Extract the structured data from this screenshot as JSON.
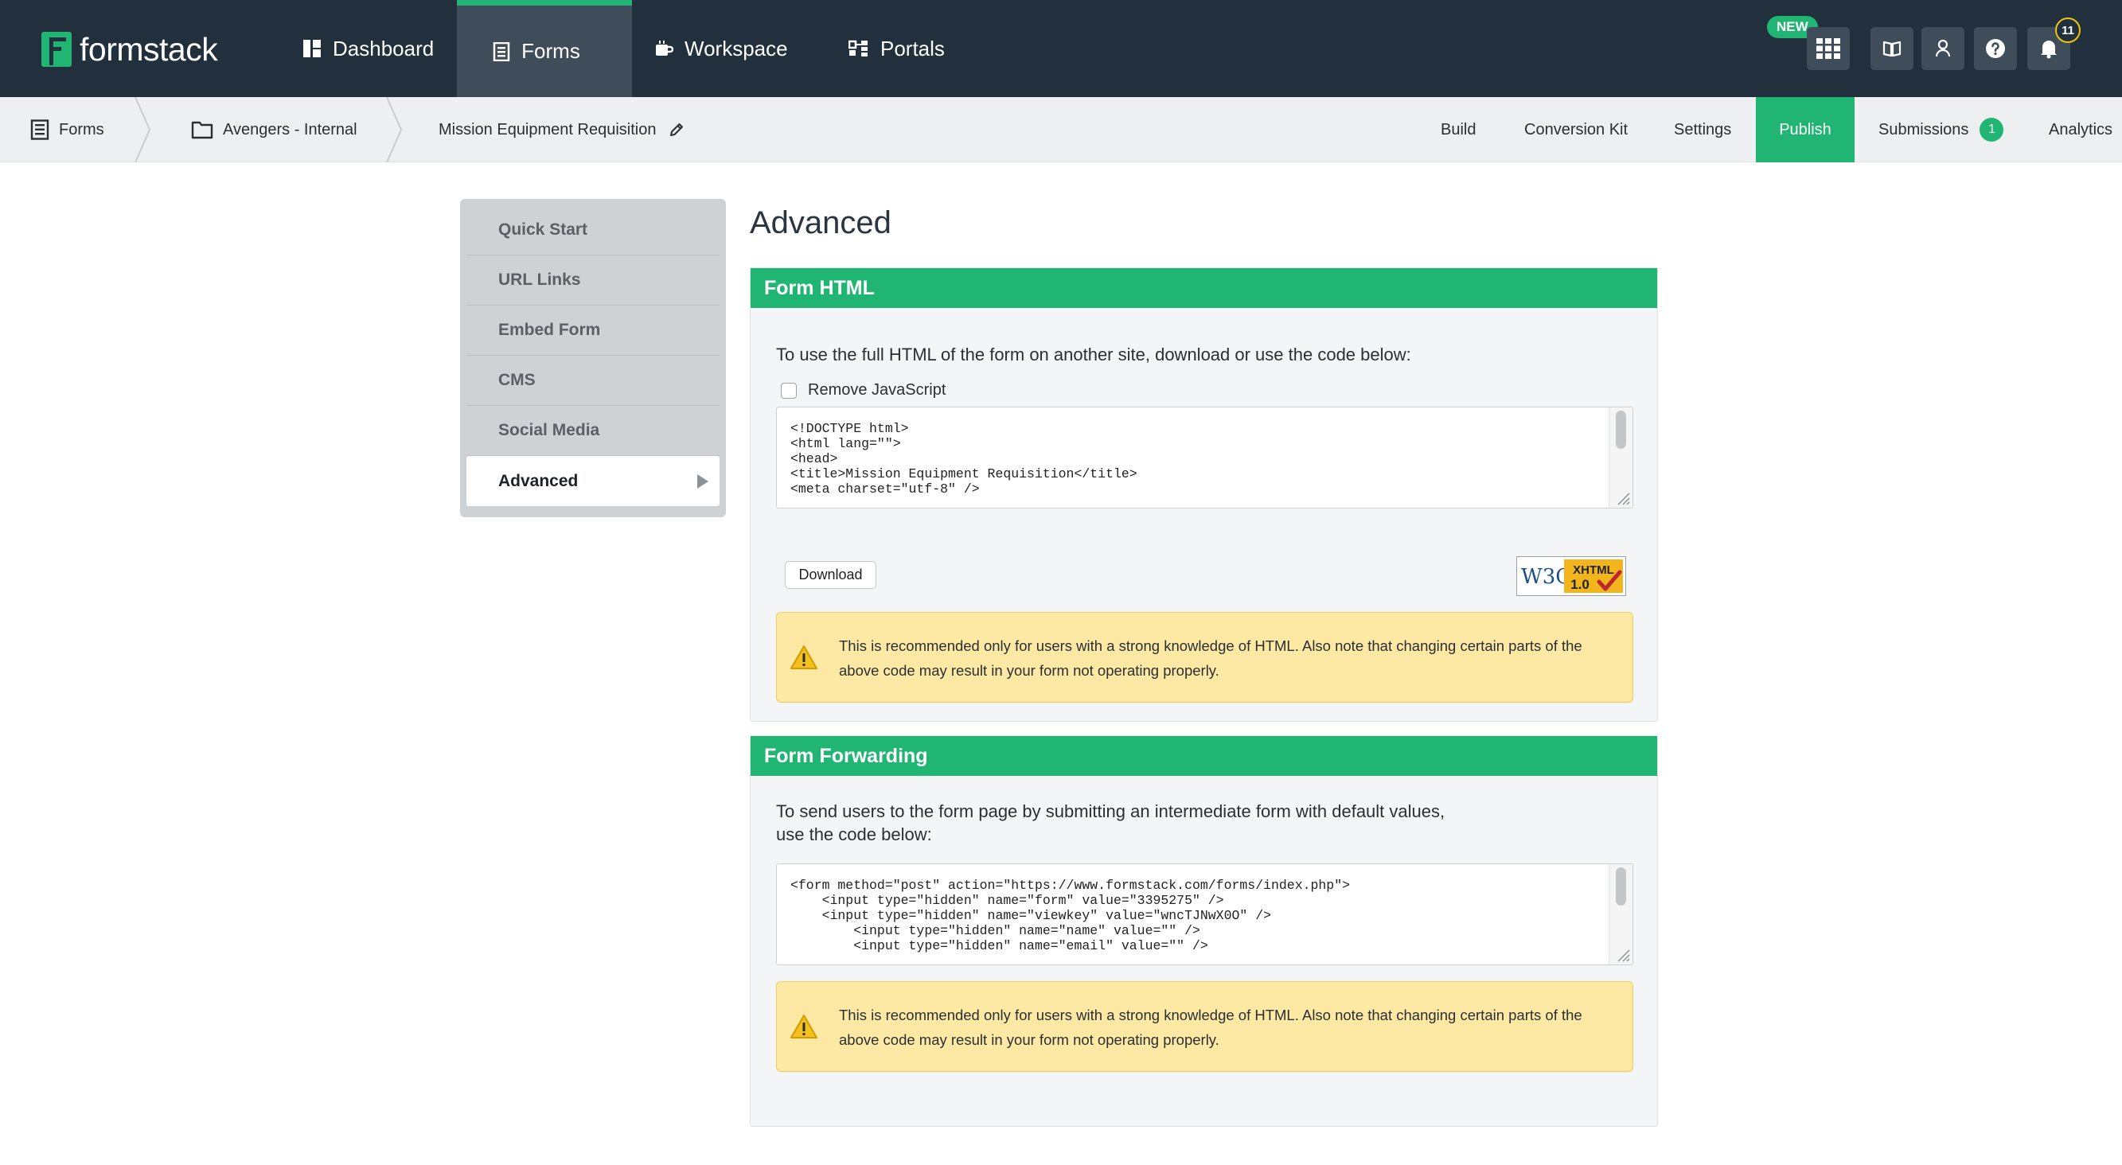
{
  "topnav": {
    "logo_text": "formstack",
    "items": [
      {
        "label": "Dashboard",
        "icon": "dashboard-icon"
      },
      {
        "label": "Forms",
        "icon": "forms-icon",
        "active": true
      },
      {
        "label": "Workspace",
        "icon": "workspace-icon"
      },
      {
        "label": "Portals",
        "icon": "portals-icon"
      }
    ],
    "new_badge": "NEW",
    "notification_count": "11",
    "utility_icons": [
      "apps-grid-icon",
      "book-icon",
      "user-icon",
      "help-icon",
      "bell-icon"
    ]
  },
  "subnav": {
    "breadcrumb": [
      {
        "label": "Forms",
        "icon": "forms-icon"
      },
      {
        "label": "Avengers - Internal",
        "icon": "folder-icon"
      },
      {
        "label": "Mission Equipment Requisition",
        "icon": "pencil-icon"
      }
    ],
    "tabs": [
      {
        "label": "Build"
      },
      {
        "label": "Conversion Kit"
      },
      {
        "label": "Settings"
      },
      {
        "label": "Publish",
        "active": true
      },
      {
        "label": "Submissions",
        "badge": "1"
      },
      {
        "label": "Analytics"
      }
    ]
  },
  "sidebar": {
    "items": [
      {
        "label": "Quick Start"
      },
      {
        "label": "URL Links"
      },
      {
        "label": "Embed Form"
      },
      {
        "label": "CMS"
      },
      {
        "label": "Social Media"
      },
      {
        "label": "Advanced",
        "active": true
      }
    ]
  },
  "main": {
    "title": "Advanced",
    "form_html": {
      "heading": "Form HTML",
      "description": "To use the full HTML of the form on another site, download or use the code below:",
      "checkbox_label": "Remove JavaScript",
      "checkbox_checked": false,
      "code_lines": [
        "<!DOCTYPE html>",
        "<html lang=\"\">",
        "<head>",
        "<title>Mission Equipment Requisition</title>",
        "<meta charset=\"utf-8\" />"
      ],
      "download_label": "Download",
      "badge_w3c": "W3C",
      "badge_xhtml": "XHTML",
      "badge_version": "1.0",
      "warning": "This is recommended only for users with a strong knowledge of HTML. Also note that changing certain parts of the above code may result in your form not operating properly."
    },
    "form_forwarding": {
      "heading": "Form Forwarding",
      "description_line1": "To send users to the form page by submitting an intermediate form with default values,",
      "description_line2": "use the code below:",
      "code_lines": [
        "<form method=\"post\" action=\"https://www.formstack.com/forms/index.php\">",
        "    <input type=\"hidden\" name=\"form\" value=\"3395275\" />",
        "    <input type=\"hidden\" name=\"viewkey\" value=\"wncTJNwX0O\" />",
        "        <input type=\"hidden\" name=\"name\" value=\"\" />",
        "        <input type=\"hidden\" name=\"email\" value=\"\" />"
      ],
      "warning": "This is recommended only for users with a strong knowledge of HTML. Also note that changing certain parts of the above code may result in your form not operating properly."
    }
  },
  "colors": {
    "nav_bg": "#21303c",
    "brand_green": "#21b573",
    "warning_bg": "#fde9a3"
  }
}
